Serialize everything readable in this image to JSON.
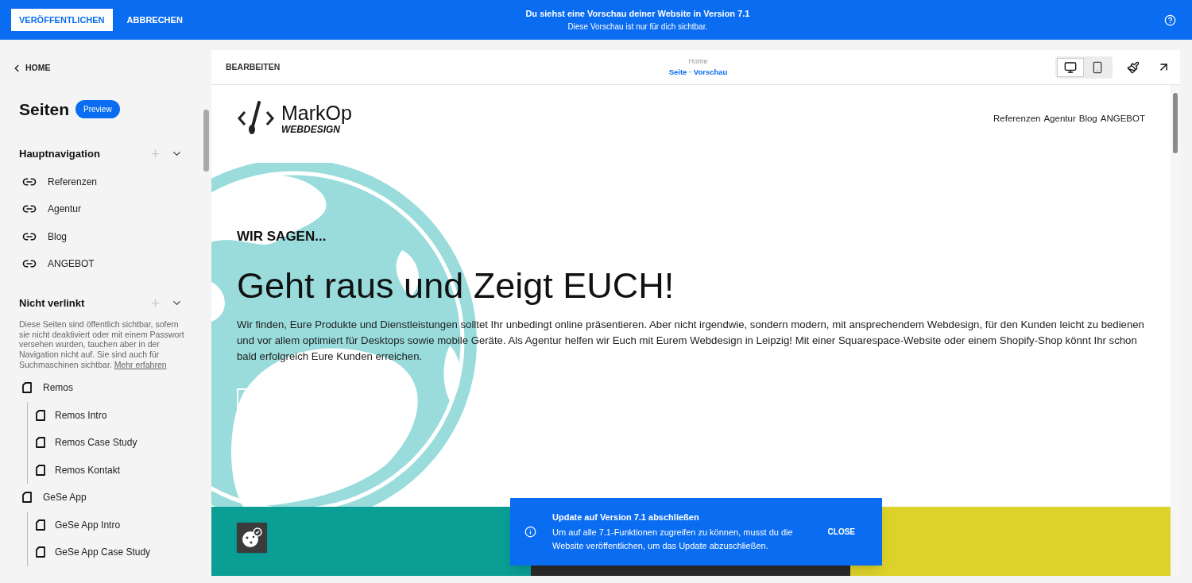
{
  "topbar": {
    "publish_button": "VERÖFFENTLICHEN",
    "cancel_button": "ABBRECHEN",
    "title": "Du siehst eine Vorschau deiner Website in Version 7.1",
    "subtitle": "Diese Vorschau ist nur für dich sichtbar."
  },
  "sidebar": {
    "back_link": "HOME",
    "heading": "Seiten",
    "badge": "Preview",
    "sections": [
      {
        "title": "Hauptnavigation",
        "expanded": true,
        "items": [
          {
            "kind": "link",
            "label": "Referenzen"
          },
          {
            "kind": "link",
            "label": "Agentur"
          },
          {
            "kind": "link",
            "label": "Blog"
          },
          {
            "kind": "link",
            "label": "ANGEBOT"
          }
        ]
      },
      {
        "title": "Nicht verlinkt",
        "expanded": true,
        "description": "Diese Seiten sind öffentlich sichtbar, sofern sie nicht deaktiviert oder mit einem Passwort versehen wurden, tauchen aber in der Navigation nicht auf. Sie sind auch für Suchmaschinen sichtbar.",
        "description_link": "Mehr erfahren",
        "items": [
          {
            "kind": "page",
            "label": "Remos",
            "children": [
              {
                "kind": "page",
                "label": "Remos Intro"
              },
              {
                "kind": "page",
                "label": "Remos Case Study"
              },
              {
                "kind": "page",
                "label": "Remos Kontakt"
              }
            ]
          },
          {
            "kind": "page",
            "label": "GeSe App",
            "children": [
              {
                "kind": "page",
                "label": "GeSe App Intro"
              },
              {
                "kind": "page",
                "label": "GeSe App Case Study"
              }
            ]
          }
        ]
      }
    ]
  },
  "preview_toolbar": {
    "edit_button": "BEARBEITEN",
    "breadcrumb": "Home",
    "subtitle": "Seite · Vorschau",
    "view_modes": [
      {
        "kind": "desktop",
        "selected": true
      },
      {
        "kind": "mobile",
        "selected": false
      }
    ]
  },
  "site": {
    "logo_name": "MarkOp",
    "logo_sub": "WEBDESIGN",
    "nav": [
      "Referenzen",
      "Agentur",
      "Blog",
      "ANGEBOT"
    ],
    "eyebrow": "WIR SAGEN...",
    "headline": "Geht raus und Zeigt EUCH!",
    "body": "Wir finden, Eure Produkte und Dienstleistungen solltet Ihr unbedingt online präsentieren. Aber nicht irgendwie, sondern modern, mit ansprechendem Webdesign, für den Kunden leicht zu bedienen und vor allem optimiert für Desktops sowie mobile Geräte. Als Agentur helfen wir Euch mit Eurem Webdesign in Leipzig! Mit einer Squarespace-Website oder einem Shopify-Shop könnt Ihr schon bald erfolgreich Eure Kunden erreichen."
  },
  "notification": {
    "title": "Update auf Version 7.1 abschließen",
    "message": "Um auf alle 7.1-Funktionen zugreifen zu können, musst du die Website veröffentlichen, um das Update abzuschließen.",
    "close": "CLOSE"
  }
}
